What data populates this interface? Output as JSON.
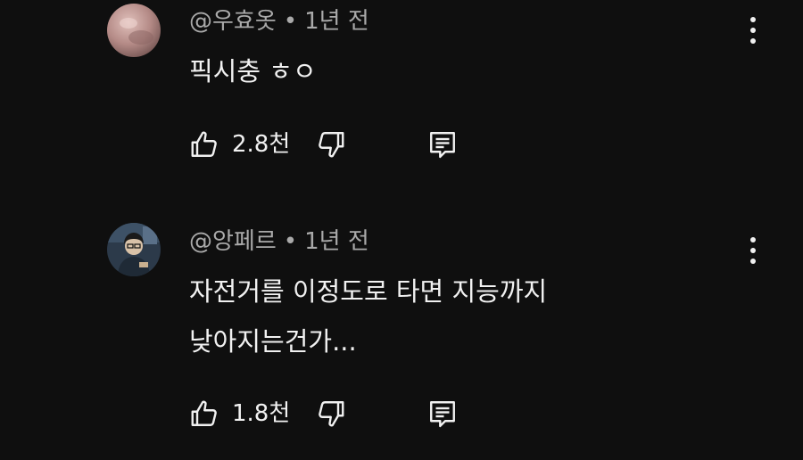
{
  "comments": [
    {
      "handle": "@우효옷",
      "time": "1년 전",
      "text_lines": [
        "픽시충 ㅎㅇ"
      ],
      "likes": "2.8천",
      "avatar_icon": "user-avatar-pink",
      "avatar_color": "#b48a86"
    },
    {
      "handle": "@앙페르",
      "time": "1년 전",
      "text_lines": [
        "자전거를 이정도로 타면 지능까지",
        "낮아지는건가..."
      ],
      "likes": "1.8천",
      "avatar_icon": "user-avatar-illustrated",
      "avatar_color": "#2c3a4a"
    }
  ],
  "separator": "•",
  "icons": {
    "like": "thumbs-up-icon",
    "dislike": "thumbs-down-icon",
    "reply": "reply-comment-icon",
    "menu": "more-vertical-icon"
  },
  "colors": {
    "background": "#0f0f0f",
    "text_primary": "#f1f1f1",
    "text_secondary": "#aaaaaa"
  }
}
